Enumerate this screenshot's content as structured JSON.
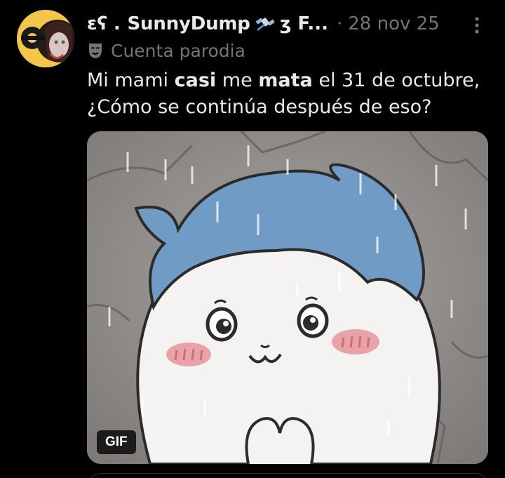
{
  "post": {
    "display_name_prefix": "ɛʕ .",
    "display_name": "SunnyDump",
    "display_name_suffix": "ʒ F...",
    "separator": "·",
    "timestamp": "28 nov 25",
    "parody_label": "Cuenta parodia",
    "text_line1_part1": "Mi mami ",
    "text_line1_bold1": "casi",
    "text_line1_part2": " me ",
    "text_line1_bold2": "mata",
    "text_line1_part3": " el 31 de octubre,",
    "text_line2": "¿Cómo se continúa después de eso?",
    "media_badge": "GIF"
  },
  "icons": {
    "name_emoji": "satellite-icon",
    "parody": "theater-mask-icon",
    "more": "more-vertical-icon"
  },
  "colors": {
    "background": "#000000",
    "primary_text": "#e7e9ea",
    "secondary_text": "#71767b",
    "character_hair": "#6f9bc4",
    "blush": "#e9a3a8"
  }
}
